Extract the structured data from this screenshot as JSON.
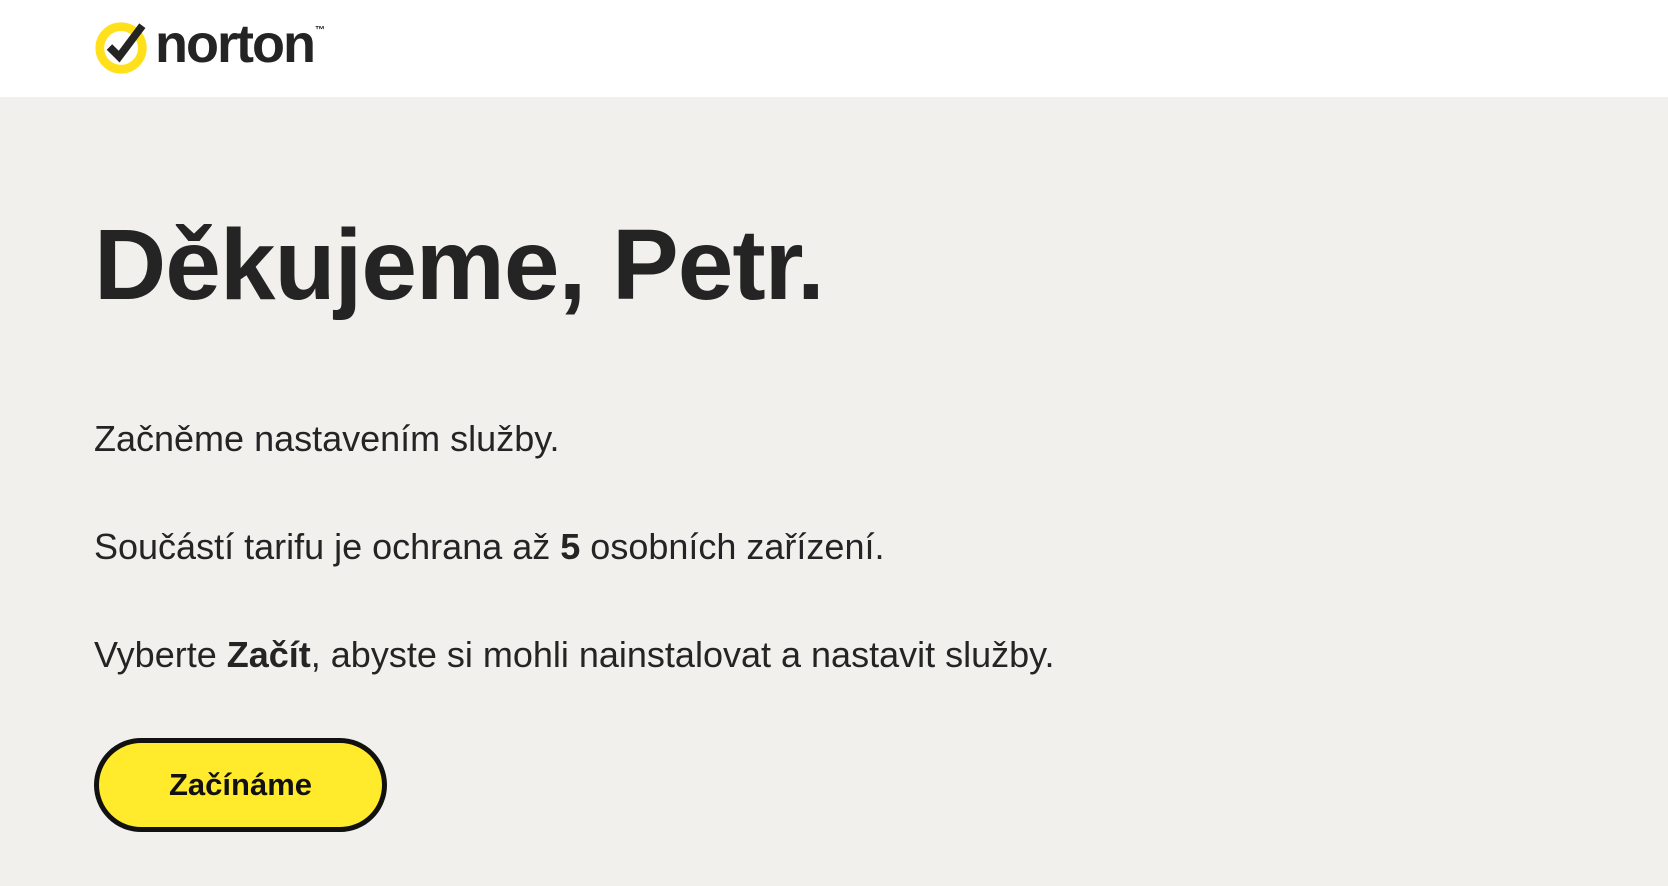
{
  "header": {
    "logo_text": "norton",
    "logo_tm": "™",
    "brand_accent": "#ffe01b"
  },
  "main": {
    "heading": "Děkujeme, Petr.",
    "intro": "Začněme nastavením služby.",
    "devices": {
      "before": "Součástí tarifu je ochrana až ",
      "count": "5",
      "after": " osobních zařízení."
    },
    "instruction": {
      "before": "Vyberte ",
      "emphasis": "Začít",
      "after": ", abyste si mohli nainstalovat a nastavit služby."
    },
    "cta_label": "Začínáme"
  },
  "colors": {
    "page_background": "#f1f0ed",
    "header_background": "#ffffff",
    "text": "#242424",
    "button_fill": "#ffeb2c",
    "button_border": "#111111"
  }
}
